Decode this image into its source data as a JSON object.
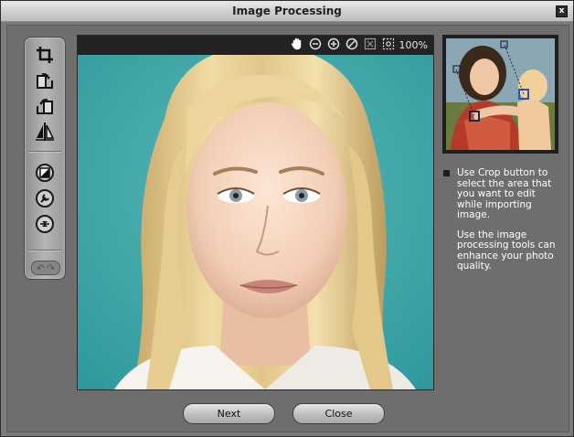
{
  "window": {
    "title": "Image Processing",
    "close_glyph": "x"
  },
  "toolbar": {
    "tools": [
      {
        "name": "crop-icon"
      },
      {
        "name": "rotate-right-icon"
      },
      {
        "name": "rotate-left-icon"
      },
      {
        "name": "flip-icon"
      },
      {
        "name": "brightness-icon"
      },
      {
        "name": "wrench-icon"
      },
      {
        "name": "balance-icon"
      }
    ],
    "undo_glyph": "↶",
    "redo_glyph": "↷"
  },
  "viewer": {
    "zoom_label": "100%",
    "icons": [
      "hand-icon",
      "zoom-out-icon",
      "zoom-in-icon",
      "reset-icon",
      "fit-icon",
      "actual-size-icon"
    ]
  },
  "help": {
    "paragraph1": "Use Crop button to select the area that you want to edit while importing image.",
    "paragraph2": "Use the image processing tools can enhance your photo quality."
  },
  "buttons": {
    "next": "Next",
    "close": "Close"
  },
  "colors": {
    "background": "#7b7b7b",
    "photo_bg": "#36a3a5"
  }
}
